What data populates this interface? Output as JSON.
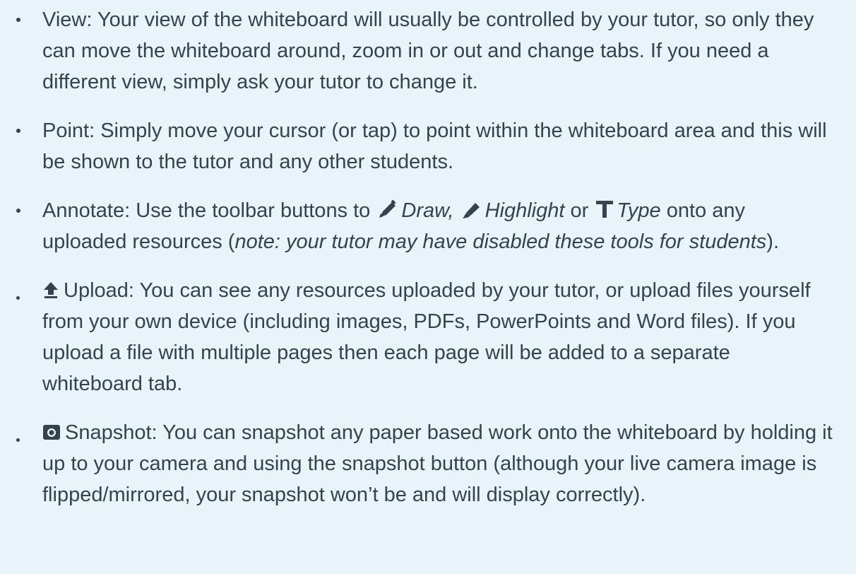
{
  "colors": {
    "background": "#e8f4f8",
    "text": "#35434e",
    "icon": "#35434e"
  },
  "items": [
    {
      "text": "View: Your view of the whiteboard will usually be controlled by your tutor, so only they can move the whiteboard around, zoom in or out and change tabs. If you need a different view, simply ask your tutor to change it."
    },
    {
      "text": "Point: Simply move your cursor (or tap) to point within the whiteboard area and this will be shown to the tutor and any other students."
    },
    {
      "prefix": "Annotate: Use the toolbar buttons to ",
      "draw": "Draw,",
      "highlight": "Highlight",
      "or": " or ",
      "type": "Type",
      "mid": " onto any uploaded resources (",
      "note": "note: your tutor may have disabled these tools for students",
      "end": ").",
      "icons": [
        "pencil-icon",
        "highlighter-icon",
        "type-icon"
      ]
    },
    {
      "icon": "upload-icon",
      "text": "Upload: You can see any resources uploaded by your tutor, or upload files yourself from your own device (including images, PDFs, PowerPoints and Word files). If you upload a file with multiple pages then each page will be added to a separate whiteboard tab."
    },
    {
      "icon": "camera-icon",
      "text": "Snapshot: You can snapshot any paper based work onto the whiteboard by holding it up to your camera and using the snapshot button (although your live camera image is flipped/mirrored, your snapshot won’t be and will display correctly)."
    }
  ]
}
